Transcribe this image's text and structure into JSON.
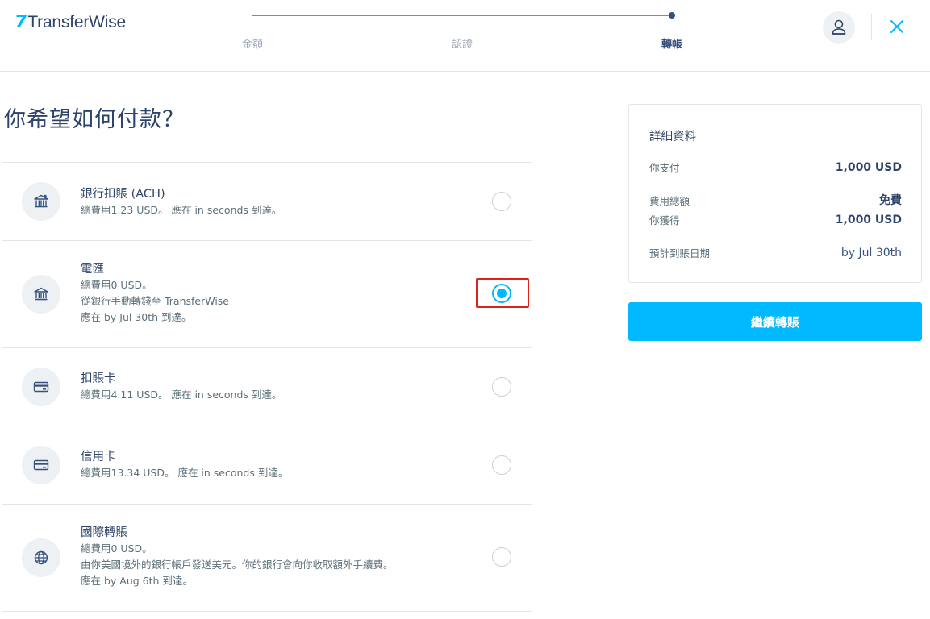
{
  "header": {
    "logo_flag": "7",
    "logo_text": "TransferWise",
    "steps": [
      {
        "label": "金額"
      },
      {
        "label": "認證"
      },
      {
        "label": "轉帳"
      }
    ],
    "active_step": 3,
    "progress_fraction": 1.0,
    "avatar_icon": "user-icon",
    "close_icon": "close-icon"
  },
  "main": {
    "title": "你希望如何付款？",
    "options": [
      {
        "icon": "bank-icon",
        "title": "銀行扣賬 (ACH)",
        "lines": [
          "總費用1.23 USD。 應在 in seconds 到達。"
        ],
        "selected": false
      },
      {
        "icon": "bank-icon",
        "title": "電匯",
        "lines": [
          "總費用0 USD。",
          "從銀行手動轉錢至 TransferWise",
          "應在 by Jul 30th 到達。"
        ],
        "selected": true
      },
      {
        "icon": "card-icon",
        "title": "扣賬卡",
        "lines": [
          "總費用4.11 USD。 應在 in seconds 到達。"
        ],
        "selected": false
      },
      {
        "icon": "card-icon",
        "title": "信用卡",
        "lines": [
          "總費用13.34 USD。 應在 in seconds 到達。"
        ],
        "selected": false
      },
      {
        "icon": "globe-icon",
        "title": "國際轉賬",
        "lines": [
          "總費用0 USD。",
          "由你美國境外的銀行帳戶發送美元。你的銀行會向你收取額外手續費。",
          "應在 by Aug 6th 到達。"
        ],
        "selected": false
      }
    ]
  },
  "summary": {
    "title": "詳細資料",
    "rows": [
      {
        "label": "你支付",
        "value": "1,000 USD"
      },
      {
        "label": "費用總額",
        "value": "免費"
      },
      {
        "label": "你獲得",
        "value": "1,000 USD"
      },
      {
        "label": "預計到賬日期",
        "value": "by Jul 30th"
      }
    ],
    "continue_label": "繼續轉賬"
  },
  "colors": {
    "accent": "#00b9ff",
    "navy": "#2e4369",
    "highlight": "#e0201b"
  }
}
